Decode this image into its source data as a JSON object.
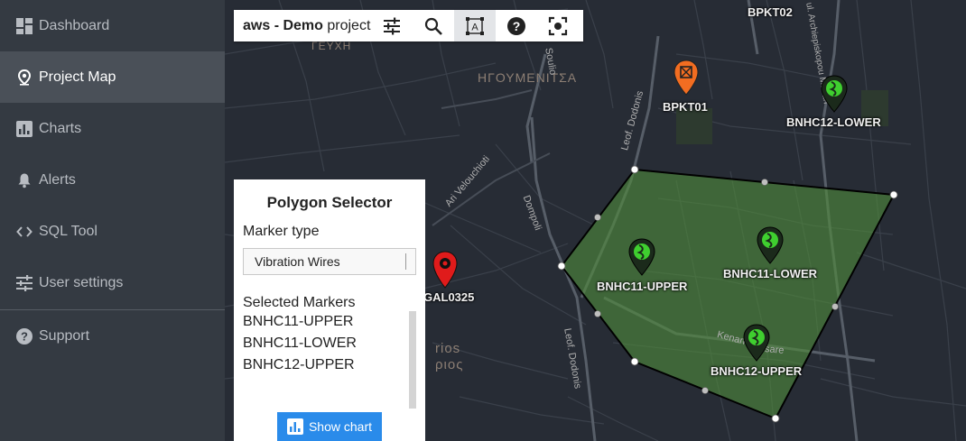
{
  "sidebar": {
    "items": [
      {
        "label": "Dashboard",
        "icon": "dashboard-icon",
        "active": false
      },
      {
        "label": "Project Map",
        "icon": "map-pin-icon",
        "active": true
      },
      {
        "label": "Charts",
        "icon": "bar-chart-icon",
        "active": false
      },
      {
        "label": "Alerts",
        "icon": "bell-icon",
        "active": false
      },
      {
        "label": "SQL Tool",
        "icon": "code-icon",
        "active": false
      },
      {
        "label": "User settings",
        "icon": "sliders-icon",
        "active": false
      }
    ],
    "support": {
      "label": "Support",
      "icon": "help-circle-icon"
    }
  },
  "toolbar": {
    "project_prefix": "aws - Demo",
    "project_suffix": "project",
    "buttons": [
      "sliders-icon",
      "search-icon",
      "text-select-icon",
      "help-icon",
      "fullscreen-icon"
    ]
  },
  "panel": {
    "title": "Polygon Selector",
    "marker_type_label": "Marker type",
    "marker_type_value": "Vibration Wires",
    "selected_title": "Selected Markers",
    "selected": [
      "BNHC11-UPPER",
      "BNHC11-LOWER",
      "BNHC12-UPPER"
    ],
    "button_label": "Show chart"
  },
  "map": {
    "area_labels": [
      "ΗΓΟΥΜΕΝΙΤΣΑ",
      "ΓΕΥΧΗ",
      "rios",
      "ριος"
    ],
    "road_labels": [
      "Leof. Dodonis",
      "Dompoli",
      "Ari Velouchioti",
      "Soulio",
      "Leof. Dodonis",
      "Kenan",
      "sare",
      "ul. Archiepiskopou Makari"
    ],
    "markers": [
      {
        "label": "BPKT02",
        "kind": "none"
      },
      {
        "label": "BPKT01",
        "kind": "orange"
      },
      {
        "label": "BNHC12-LOWER",
        "kind": "green"
      },
      {
        "label": "BNHC11-UPPER",
        "kind": "green"
      },
      {
        "label": "BNHC11-LOWER",
        "kind": "green"
      },
      {
        "label": "BNHC12-UPPER",
        "kind": "green"
      },
      {
        "label": "GAL0325",
        "kind": "red"
      }
    ],
    "colors": {
      "polygon_fill": "#4f8a3c",
      "polygon_stroke": "#000000",
      "green_marker": "#3fcf2f",
      "orange_marker": "#f26d21",
      "red_marker": "#e01b1b"
    }
  }
}
